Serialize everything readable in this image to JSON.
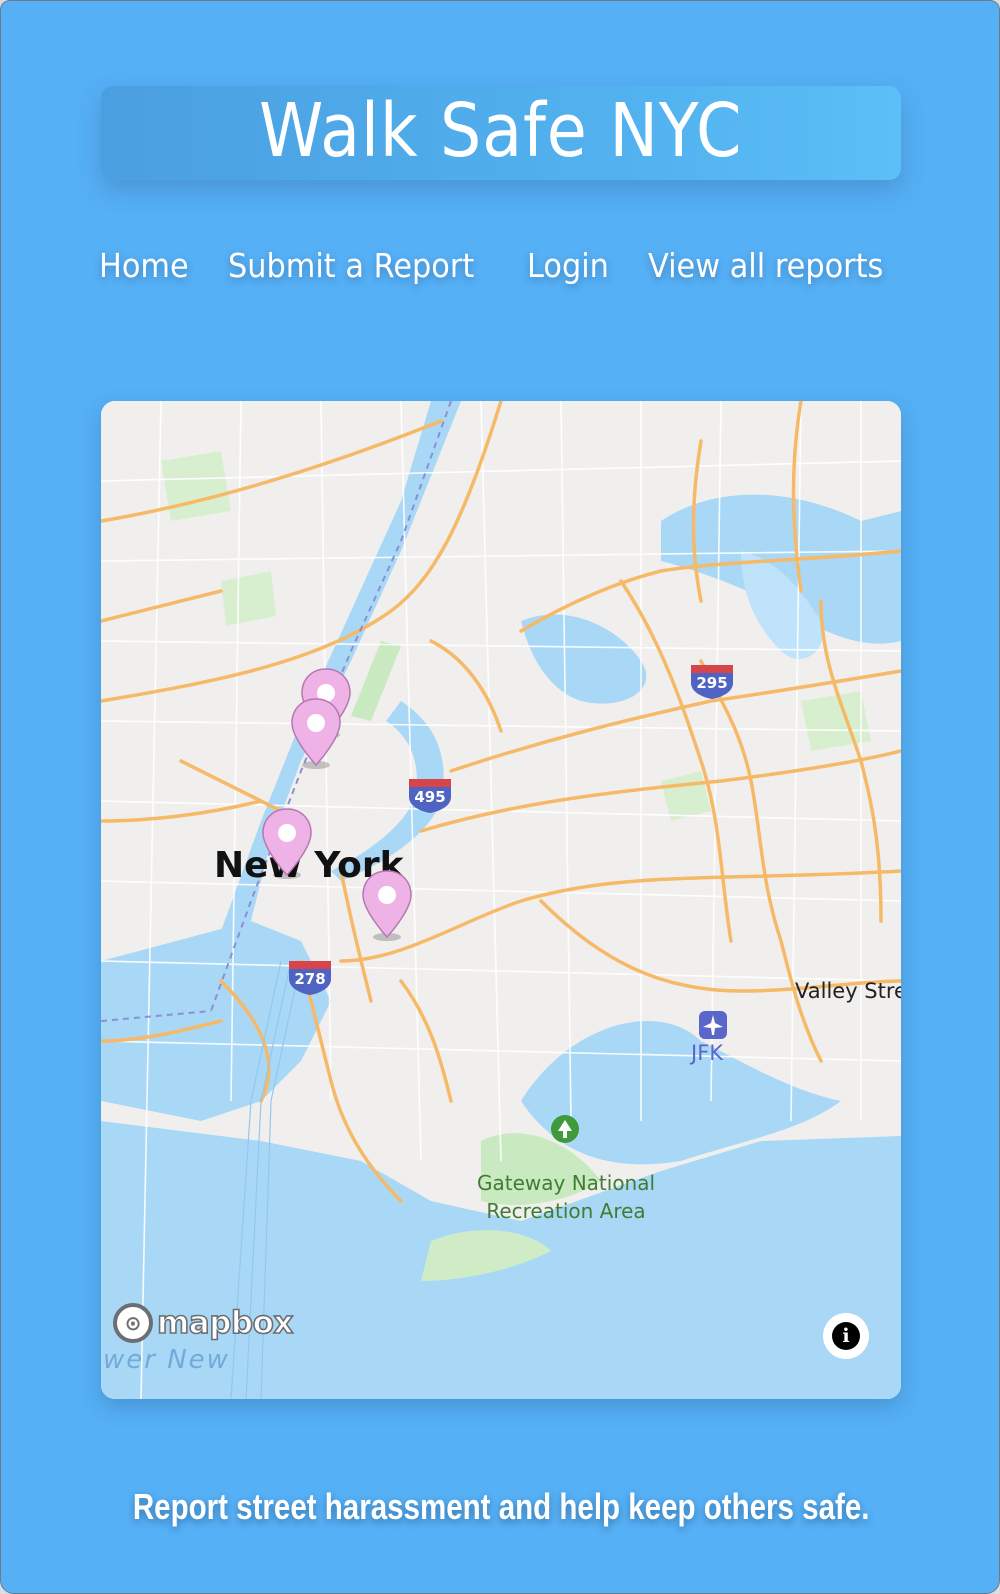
{
  "header": {
    "title": "Walk Safe NYC"
  },
  "nav": {
    "items": [
      {
        "label": "Home"
      },
      {
        "label": "Submit a Report"
      },
      {
        "label": "Login"
      },
      {
        "label": "View all reports"
      }
    ]
  },
  "map": {
    "labels": {
      "city": "New York",
      "valley": "Valley Stre",
      "airport": "JFK",
      "park_line1": "Gateway National",
      "park_line2": "Recreation Area",
      "lower": "wer New"
    },
    "highway_shields": [
      "295",
      "495",
      "278"
    ],
    "attribution": {
      "logo_text": "mapbox",
      "info_symbol": "i"
    },
    "marker_count": 4,
    "colors": {
      "water": "#a9d8f7",
      "land": "#f1efee",
      "park": "#c9e9c0",
      "road": "#f6b967",
      "marker": "#efb2e6",
      "shield_red": "#d6454a",
      "shield_blue": "#4f63c3"
    }
  },
  "footer": {
    "tagline": "Report street harassment and help keep others safe."
  },
  "colors": {
    "background": "#56b0f5",
    "text": "#ffffff"
  }
}
